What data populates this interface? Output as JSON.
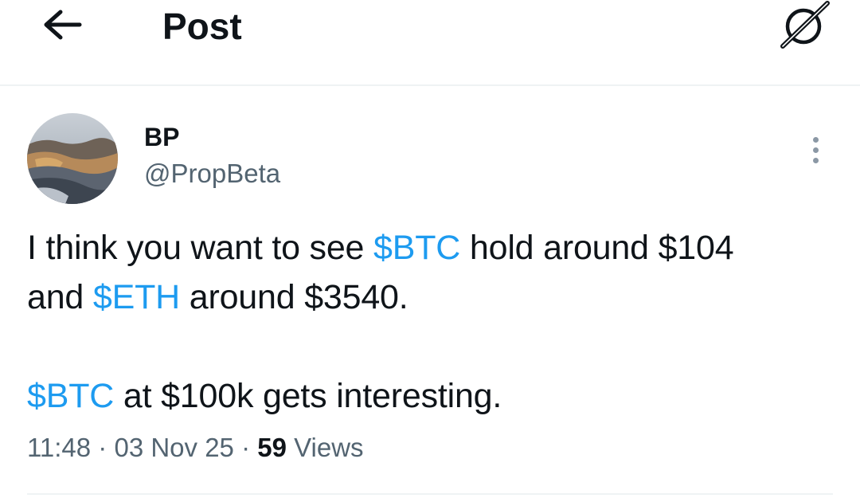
{
  "header": {
    "title": "Post",
    "back_icon": "arrow-left-icon",
    "grok_icon": "grok-icon"
  },
  "author": {
    "display_name": "BP",
    "handle": "@PropBeta",
    "avatar": "landscape-photo-avatar"
  },
  "tweet": {
    "line1_a": "I think you want to see ",
    "line1_tag": "$BTC",
    "line1_b": " hold around $104",
    "line2_a": "and ",
    "line2_tag": "$ETH",
    "line2_b": " around $3540.",
    "line3_tag": "$BTC",
    "line3_b": " at $100k gets interesting."
  },
  "meta": {
    "time": "11:48",
    "sep1": " · ",
    "date": "03 Nov 25",
    "sep2": " · ",
    "views_count": "59",
    "views_label": " Views"
  },
  "colors": {
    "accent": "#1d9bf0",
    "secondary_text": "#536471",
    "primary_text": "#0f1419",
    "divider": "#eff3f4"
  }
}
